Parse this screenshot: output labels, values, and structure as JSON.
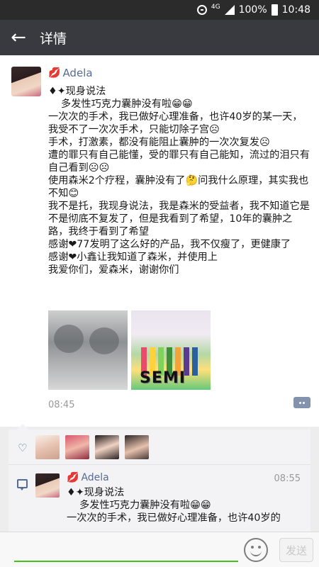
{
  "status_bar": {
    "network": "4G",
    "battery": "100%",
    "time": "10:48"
  },
  "header": {
    "back_icon": "back-arrow-icon",
    "title": "详情"
  },
  "post": {
    "author": "Adela",
    "lines": [
      "♦✦现身说法",
      "    多发性巧克力囊肿没有啦😁😁",
      "一次次的手术，我已做好心理准备，也许40岁的某一天，我受不了一次次手术，只能切除子宫☹",
      "手术，打激素，都没有能阻止囊肿的一次次复发☹",
      "遭的罪只有自己能懂，受的罪只有自己能知，流过的泪只有自己看到☹☹",
      "使用森米2个疗程，囊肿没有了🤔问我什么原理，其实我也不知😊",
      "我不是托，我现身说法，我是森米的受益者，我不知道它是不是彻底不复发了，但是我看到了希望，10年的囊肿之路，我终于看到了希望",
      "感谢❤77发明了这么好的产品，我不仅瘦了，更健康了",
      "感谢❤小鑫让我知道了森米，并使用上",
      "我爱你们，爱森米，谢谢你们"
    ],
    "photo_brand_text": "SEMI",
    "time": "08:45"
  },
  "comment": {
    "author": "Adela",
    "time": "08:55",
    "lines": [
      "♦✦现身说法",
      "    多发性巧克力囊肿没有啦😁😁",
      "一次次的手术，我已做好心理准备，也许40岁的"
    ]
  },
  "input": {
    "placeholder": "",
    "send_label": "发送"
  },
  "colors": {
    "header_bg": "#393a3f",
    "link_blue": "#576b95",
    "accent_green": "#45c01a"
  }
}
